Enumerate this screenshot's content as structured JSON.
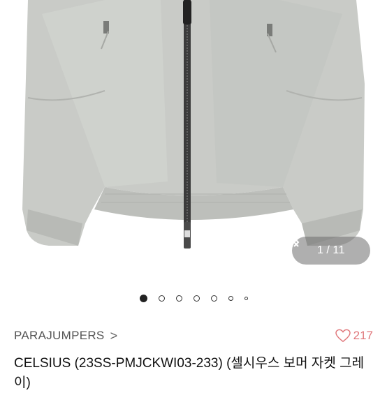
{
  "gallery": {
    "image_icon": "jacket-photo",
    "counter": {
      "current": "1",
      "separator": "/",
      "total": "11"
    },
    "prev_icon": "chevron-left-icon",
    "next_icon": "chevron-right-icon",
    "dots": {
      "count": 7,
      "active_index": 0
    }
  },
  "product": {
    "brand": "PARAJUMPERS",
    "brand_chevron": ">",
    "likes": "217",
    "like_icon": "heart-icon",
    "like_color": "#e0767a",
    "title": "CELSIUS (23SS-PMJCKWI03-233) (셀시우스 보머 자켓 그레이)"
  }
}
